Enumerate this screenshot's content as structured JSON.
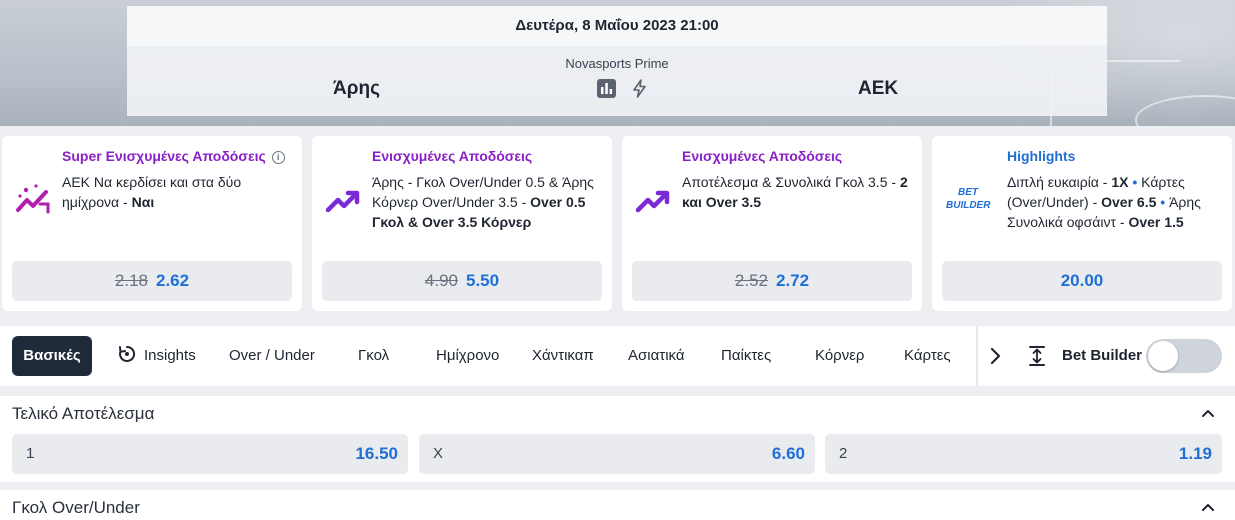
{
  "match": {
    "date": "Δευτέρα, 8 Μαΐου 2023 21:00",
    "channel": "Novasports Prime",
    "home_team": "Άρης",
    "away_team": "ΑΕΚ"
  },
  "promos": [
    {
      "title": "Super Ενισχυμένες Αποδόσεις",
      "desc_text": "ΑΕΚ Να κερδίσει και στα δύο ημίχρονα - ",
      "desc_bold": "Ναι",
      "old_odds": "2.18",
      "new_odds": "2.62",
      "icon": "super-boost-icon"
    },
    {
      "title": "Ενισχυμένες Αποδόσεις",
      "desc_text": "Άρης - Γκολ Over/Under 0.5 & Άρης Κόρνερ Over/Under 3.5 - ",
      "desc_bold": "Over 0.5 Γκολ & Over 3.5 Κόρνερ",
      "old_odds": "4.90",
      "new_odds": "5.50",
      "icon": "trend-up-icon"
    },
    {
      "title": "Ενισχυμένες Αποδόσεις",
      "desc_text": "Αποτέλεσμα & Συνολικά Γκολ 3.5 - ",
      "desc_bold": "2 και Over 3.5",
      "old_odds": "2.52",
      "new_odds": "2.72",
      "icon": "trend-up-icon"
    },
    {
      "title": "Highlights",
      "desc_parts": [
        "Διπλή ευκαιρία - ",
        "1X",
        " • ",
        "Κάρτες (Over/Under) - ",
        "Over 6.5",
        " • ",
        "Άρης Συνολικά οφσάιντ - ",
        "Over 1.5"
      ],
      "odds": "20.00",
      "icon": "bet-builder-icon",
      "icon_text_1": "BET",
      "icon_text_2": "BUILDER"
    }
  ],
  "tabs": {
    "active": "Βασικές",
    "insights": "Insights",
    "items": [
      "Over / Under",
      "Γκολ",
      "Ημίχρονο",
      "Χάντικαπ",
      "Ασιατικά",
      "Παίκτες",
      "Κόρνερ",
      "Κάρτες"
    ],
    "bet_builder": "Bet Builder",
    "bet_builder_enabled": false
  },
  "markets": [
    {
      "title": "Τελικό Αποτέλεσμα",
      "outcomes": [
        {
          "label": "1",
          "odds": "16.50"
        },
        {
          "label": "X",
          "odds": "6.60"
        },
        {
          "label": "2",
          "odds": "1.19"
        }
      ]
    },
    {
      "title": "Γκολ Over/Under"
    }
  ],
  "colors": {
    "accent_blue": "#1f6fd6",
    "accent_purple": "#8a1fc6",
    "dark": "#1f2a3a"
  }
}
